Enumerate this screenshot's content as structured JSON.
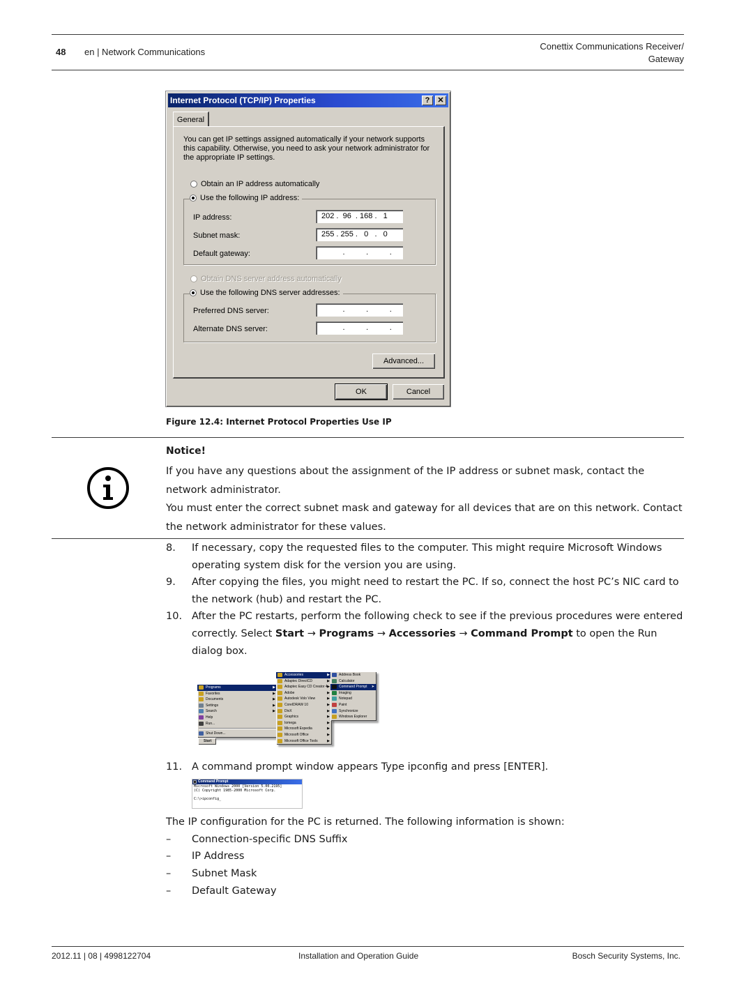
{
  "header": {
    "page_number": "48",
    "section": "en | Network Communications",
    "doc_title_line1": "Conettix Communications Receiver/",
    "doc_title_line2": "Gateway"
  },
  "dialog": {
    "title": "Internet Protocol (TCP/IP) Properties",
    "help_button": "?",
    "close_button": "✕",
    "tab_general": "General",
    "intro_text": "You can get IP settings assigned automatically if your network supports this capability. Otherwise, you need to ask your network administrator for the appropriate IP settings.",
    "radio_obtain_ip": {
      "label": "Obtain an IP address automatically",
      "selected": false
    },
    "radio_use_ip": {
      "label": "Use the following IP address:",
      "selected": true
    },
    "ip_address": {
      "label": "IP address:",
      "value": "202 .  96  . 168 .   1"
    },
    "subnet_mask": {
      "label": "Subnet mask:",
      "value": "255 . 255 .   0   .   0"
    },
    "default_gateway": {
      "label": "Default gateway:",
      "value": "          .          .          ."
    },
    "radio_obtain_dns": {
      "label": "Obtain DNS server address automatically",
      "selected": false,
      "disabled": true
    },
    "radio_use_dns": {
      "label": "Use the following DNS server addresses:",
      "selected": true
    },
    "preferred_dns": {
      "label": "Preferred DNS server:",
      "value": "          .          .          ."
    },
    "alternate_dns": {
      "label": "Alternate DNS server:",
      "value": "          .          .          ."
    },
    "advanced_button": "Advanced...",
    "ok_button": "OK",
    "cancel_button": "Cancel"
  },
  "figure_caption": "Figure 12.4: Internet Protocol Properties Use IP",
  "notice": {
    "title": "Notice!",
    "paragraph1": "If you have any questions about the assignment of the IP address or subnet mask, contact the network administrator.",
    "paragraph2": "You must enter the correct subnet mask and gateway for all devices that are on this network. Contact the network administrator for these values."
  },
  "steps": [
    {
      "num": "8.",
      "text": "If necessary, copy the requested files to the computer. This might require Microsoft Windows operating system disk for the version you are using."
    },
    {
      "num": "9.",
      "text": "After copying the files, you might need to restart the PC. If so, connect the host PC’s NIC card to the network (hub) and restart the PC."
    },
    {
      "num": "10.",
      "text_before": "After the PC restarts, perform the following check to see if the previous procedures were entered correctly. Select ",
      "path": [
        "Start",
        "Programs",
        "Accessories",
        "Command Prompt"
      ],
      "arrow": " → ",
      "text_after": " to open the Run dialog box."
    },
    {
      "num": "11.",
      "text": "A command prompt window appears Type ipconfig and press [ENTER]."
    }
  ],
  "start_menu": {
    "start_label": "Start",
    "main_items": [
      "Programs",
      "Favorites",
      "Documents",
      "Settings",
      "Search",
      "Help",
      "Run...",
      "Shut Down..."
    ],
    "programs_items": [
      "Accessories",
      "Adaptec DirectCD",
      "Adaptec Easy CD Creator 4",
      "Adobe",
      "Autodesk Volo View",
      "CorelDRAW 10",
      "DivX",
      "Graphics",
      "Iomega",
      "Microsoft Expedia",
      "Microsoft Office",
      "Microsoft Office Tools"
    ],
    "accessories_items": [
      "Address Book",
      "Calculator",
      "Command Prompt",
      "Imaging",
      "Notepad",
      "Paint",
      "Synchronize",
      "Windows Explorer"
    ]
  },
  "command_prompt": {
    "title": "Command Prompt",
    "line1": "Microsoft Windows 2000 [Version 5.00.2195]",
    "line2": "(C) Copyright 1985-2000 Microsoft Corp.",
    "line3": "",
    "line4": "C:\\>ipconfig_"
  },
  "ip_result_intro": "The IP configuration for the PC is returned. The following information is shown:",
  "ip_result_items": [
    "Connection-specific DNS Suffix",
    "IP Address",
    "Subnet Mask",
    "Default Gateway"
  ],
  "bullet_dash": "–",
  "footer": {
    "left": "2012.11 | 08 | 4998122704",
    "center": "Installation and Operation Guide",
    "right": "Bosch Security Systems, Inc."
  }
}
